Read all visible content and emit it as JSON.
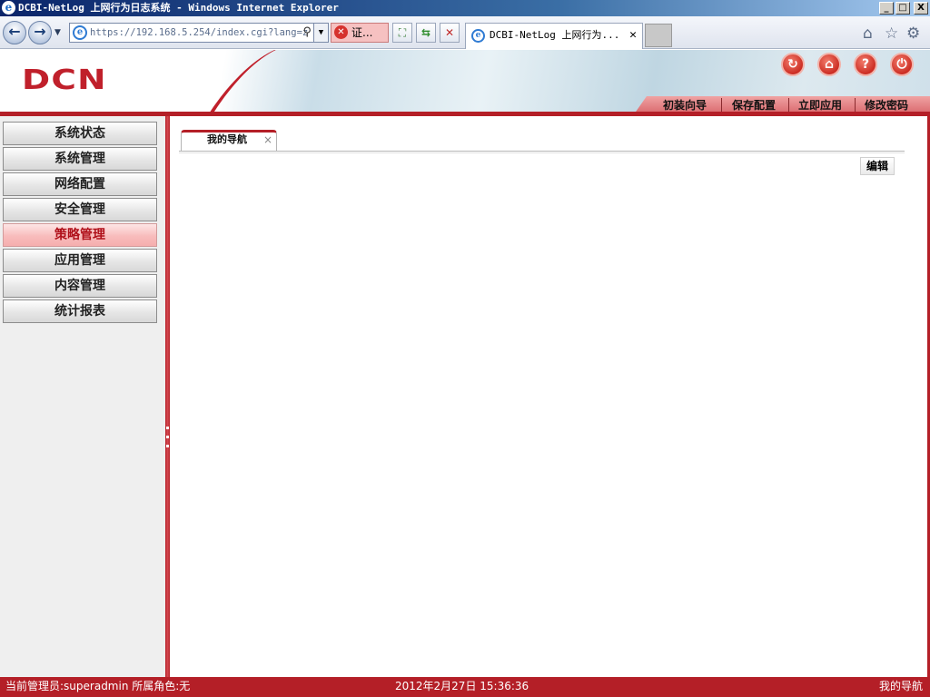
{
  "window": {
    "title": "DCBI-NetLog 上网行为日志系统 - Windows Internet Explorer",
    "controls": {
      "minimize": "_",
      "maximize": "□",
      "close": "X"
    }
  },
  "browser": {
    "address": "https://192.168.5.254/index.cgi?lang=z",
    "cert_label": "证...",
    "tab_title": "DCBI-NetLog 上网行为...",
    "tab_close": "✕",
    "icons": [
      "back-icon",
      "forward-icon",
      "search-icon",
      "certificate-error-icon",
      "compatibility-icon",
      "refresh-icon",
      "stop-icon",
      "home-icon",
      "favorites-icon",
      "gear-icon"
    ]
  },
  "header": {
    "logo": "DCN",
    "menu": [
      "初装向导",
      "保存配置",
      "立即应用",
      "修改密码"
    ],
    "accent_color": "#b41f27"
  },
  "sidebar": {
    "items": [
      {
        "label": "系统状态"
      },
      {
        "label": "系统管理"
      },
      {
        "label": "网络配置"
      },
      {
        "label": "安全管理"
      },
      {
        "label": "策略管理",
        "active": true
      },
      {
        "label": "应用管理"
      },
      {
        "label": "内容管理"
      },
      {
        "label": "统计报表"
      }
    ]
  },
  "content": {
    "tab_label": "我的导航",
    "tab_close": "×",
    "edit_label": "编辑"
  },
  "statusbar": {
    "user": "当前管理员:superadmin  所属角色:无",
    "time": "2012年2月27日 15:36:36",
    "location": "我的导航"
  }
}
